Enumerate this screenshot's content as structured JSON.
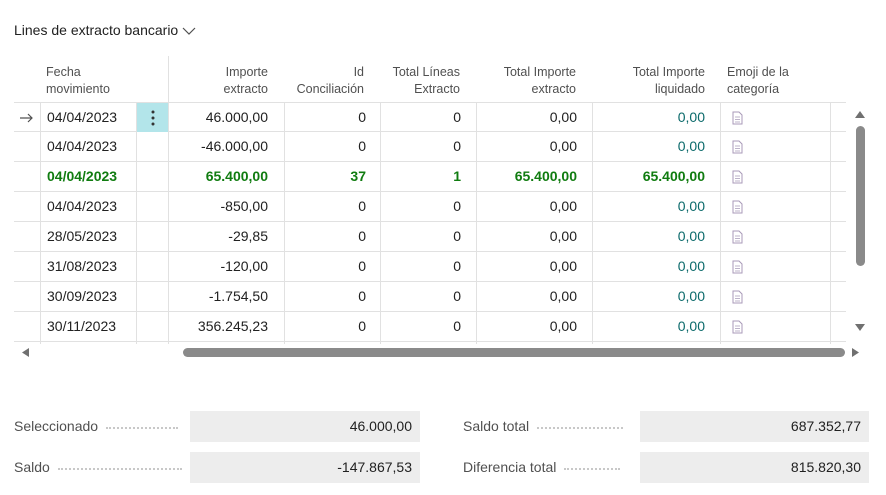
{
  "section": {
    "title": "Lines de extracto bancario"
  },
  "columns": {
    "fecha": [
      "Fecha",
      "movimiento"
    ],
    "importe": [
      "Importe",
      "extracto"
    ],
    "id": [
      "Id",
      "Conciliación"
    ],
    "total_lineas": [
      "Total Líneas",
      "Extracto"
    ],
    "total_importe": [
      "Total Importe",
      "extracto"
    ],
    "total_liquidado": [
      "Total Importe",
      "liquidado"
    ],
    "emoji": [
      "Emoji de la",
      "categoría"
    ]
  },
  "rows": [
    {
      "fecha": "04/04/2023",
      "importe": "46.000,00",
      "id": "0",
      "lineas": "0",
      "total": "0,00",
      "liquidado": "0,00"
    },
    {
      "fecha": "04/04/2023",
      "importe": "-46.000,00",
      "id": "0",
      "lineas": "0",
      "total": "0,00",
      "liquidado": "0,00"
    },
    {
      "fecha": "04/04/2023",
      "importe": "65.400,00",
      "id": "37",
      "lineas": "1",
      "total": "65.400,00",
      "liquidado": "65.400,00"
    },
    {
      "fecha": "04/04/2023",
      "importe": "-850,00",
      "id": "0",
      "lineas": "0",
      "total": "0,00",
      "liquidado": "0,00"
    },
    {
      "fecha": "28/05/2023",
      "importe": "-29,85",
      "id": "0",
      "lineas": "0",
      "total": "0,00",
      "liquidado": "0,00"
    },
    {
      "fecha": "31/08/2023",
      "importe": "-120,00",
      "id": "0",
      "lineas": "0",
      "total": "0,00",
      "liquidado": "0,00"
    },
    {
      "fecha": "30/09/2023",
      "importe": "-1.754,50",
      "id": "0",
      "lineas": "0",
      "total": "0,00",
      "liquidado": "0,00"
    },
    {
      "fecha": "30/11/2023",
      "importe": "356.245,23",
      "id": "0",
      "lineas": "0",
      "total": "0,00",
      "liquidado": "0,00"
    }
  ],
  "totals": {
    "seleccionado": {
      "label": "Seleccionado",
      "value": "46.000,00"
    },
    "saldo": {
      "label": "Saldo",
      "value": "-147.867,53"
    },
    "saldo_total": {
      "label": "Saldo total",
      "value": "687.352,77"
    },
    "diferencia_total": {
      "label": "Diferencia total",
      "value": "815.820,30"
    }
  },
  "colors": {
    "highlight": "#107c10",
    "liquidado": "#0b6a6b",
    "selected_cell": "#b3e5ea"
  },
  "icons": {
    "row_indicator": "arrow-right-icon",
    "row_menu": "more-vertical-icon",
    "category": "document-icon"
  }
}
